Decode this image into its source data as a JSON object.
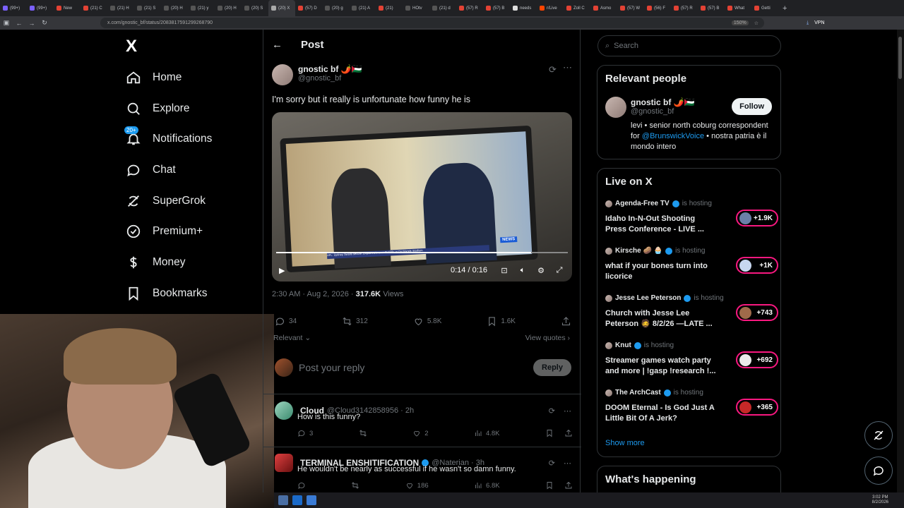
{
  "browser": {
    "tabs": [
      {
        "label": "(99+)",
        "color": "#7b61ff"
      },
      {
        "label": "(99+)",
        "color": "#7b61ff"
      },
      {
        "label": "New",
        "color": "#e34234"
      },
      {
        "label": "(21) C",
        "color": "#e34234"
      },
      {
        "label": "(21) H",
        "color": "#555"
      },
      {
        "label": "(21) S",
        "color": "#555"
      },
      {
        "label": "(20) H",
        "color": "#555"
      },
      {
        "label": "(21) y",
        "color": "#555"
      },
      {
        "label": "(20) H",
        "color": "#555"
      },
      {
        "label": "(20) S",
        "color": "#555"
      },
      {
        "label": "(20) X",
        "color": "#aaa",
        "active": true
      },
      {
        "label": "(57) D",
        "color": "#e34234"
      },
      {
        "label": "(20) g",
        "color": "#555"
      },
      {
        "label": "(21) A",
        "color": "#555"
      },
      {
        "label": "(21)",
        "color": "#e34234"
      },
      {
        "label": "HOtv",
        "color": "#555"
      },
      {
        "label": "(21) d",
        "color": "#555"
      },
      {
        "label": "(57) R",
        "color": "#e34234"
      },
      {
        "label": "(57) B",
        "color": "#e34234"
      },
      {
        "label": "needs",
        "color": "#ddd"
      },
      {
        "label": "r/Live",
        "color": "#ff4500"
      },
      {
        "label": "Zoll C",
        "color": "#e34234"
      },
      {
        "label": "Asmo",
        "color": "#e34234"
      },
      {
        "label": "(57) W",
        "color": "#e34234"
      },
      {
        "label": "(56) F",
        "color": "#e34234"
      },
      {
        "label": "(57) R",
        "color": "#e34234"
      },
      {
        "label": "(57) B",
        "color": "#e34234"
      },
      {
        "label": "What",
        "color": "#e34234"
      },
      {
        "label": "Getti",
        "color": "#e34234"
      }
    ],
    "url": "x.com/gnostic_bf/status/2083817591299268790",
    "zoom": "150%",
    "vpn": "VPN"
  },
  "nav": {
    "logo": "X",
    "items": [
      {
        "label": "Home",
        "icon": "home-icon"
      },
      {
        "label": "Explore",
        "icon": "search-icon"
      },
      {
        "label": "Notifications",
        "icon": "bell-icon",
        "badge": "20+"
      },
      {
        "label": "Chat",
        "icon": "chat-icon"
      },
      {
        "label": "SuperGrok",
        "icon": "grok-icon"
      },
      {
        "label": "Premium+",
        "icon": "verified-icon"
      },
      {
        "label": "Money",
        "icon": "dollar-icon"
      },
      {
        "label": "Bookmarks",
        "icon": "bookmark-icon"
      }
    ]
  },
  "post": {
    "header": "Post",
    "author_name": "gnostic bf 🌶️🇵🇸",
    "author_handle": "@gnostic_bf",
    "text": "I'm sorry but it really is unfortunate how funny he is",
    "video": {
      "time": "0:14 / 0:16",
      "progress": 0.875,
      "news_tag": "NEWS",
      "caption": "AFL: Sydney Swans secure 19-point win over St Kilda at Docklands Stadium"
    },
    "time": "2:30 AM · Aug 2, 2026 ·",
    "views": "317.6K",
    "views_label": "Views",
    "replies": "34",
    "reposts": "312",
    "likes": "5.8K",
    "bookmarks": "1.6K",
    "relevant": "Relevant ⌄",
    "view_quotes": "View quotes ›",
    "reply_placeholder": "Post your reply",
    "reply_button": "Reply"
  },
  "comments": [
    {
      "name": "Cloud",
      "handle": "@Cloud3142858956 · 2h",
      "text": "How is this funny?",
      "replies": "3",
      "reposts": "",
      "likes": "2",
      "views": "4.8K"
    },
    {
      "name": "TERMINAL ENSHITIFICATION",
      "handle": "@Naterian · 3h",
      "text": "He wouldn't be nearly as successful if he wasn't so damn funny.",
      "replies": "",
      "reposts": "",
      "likes": "186",
      "views": "6.8K"
    }
  ],
  "sidebar": {
    "search_placeholder": "Search",
    "relevant_title": "Relevant people",
    "person_name": "gnostic bf 🌶️🇵🇸",
    "person_handle": "@gnostic_bf",
    "follow": "Follow",
    "bio_1": "levi • senior north coburg correspondent for",
    "bio_link": "@BrunswickVoice",
    "bio_2": "• nostra patria è il mondo intero",
    "live_title": "Live on X",
    "live": [
      {
        "host": "Agenda-Free TV",
        "status": "is hosting",
        "title": "Idaho In-N-Out Shooting Press Conference - LIVE ...",
        "count": "+1.9K"
      },
      {
        "host": "Kirsche 🥔 🧁",
        "status": "is hosting",
        "title": "what if your bones turn into licorice",
        "count": "+1K"
      },
      {
        "host": "Jesse Lee Peterson",
        "status": "is hosting",
        "title": "Church with Jesse Lee Peterson 🧔 8/2/26 —LATE ...",
        "count": "+743"
      },
      {
        "host": "Knut",
        "status": "is hosting",
        "title": "Streamer games watch party and more | !gasp !research !...",
        "count": "+692"
      },
      {
        "host": "The ArchCast",
        "status": "is hosting",
        "title": "DOOM Eternal - Is God Just A Little Bit Of A Jerk?",
        "count": "+365"
      }
    ],
    "show_more": "Show more",
    "happening_title": "What's happening"
  },
  "taskbar": {
    "time": "3:02 PM",
    "date": "8/2/2026"
  },
  "colors": {
    "accent": "#1d9bf0",
    "live": "#f91880"
  }
}
